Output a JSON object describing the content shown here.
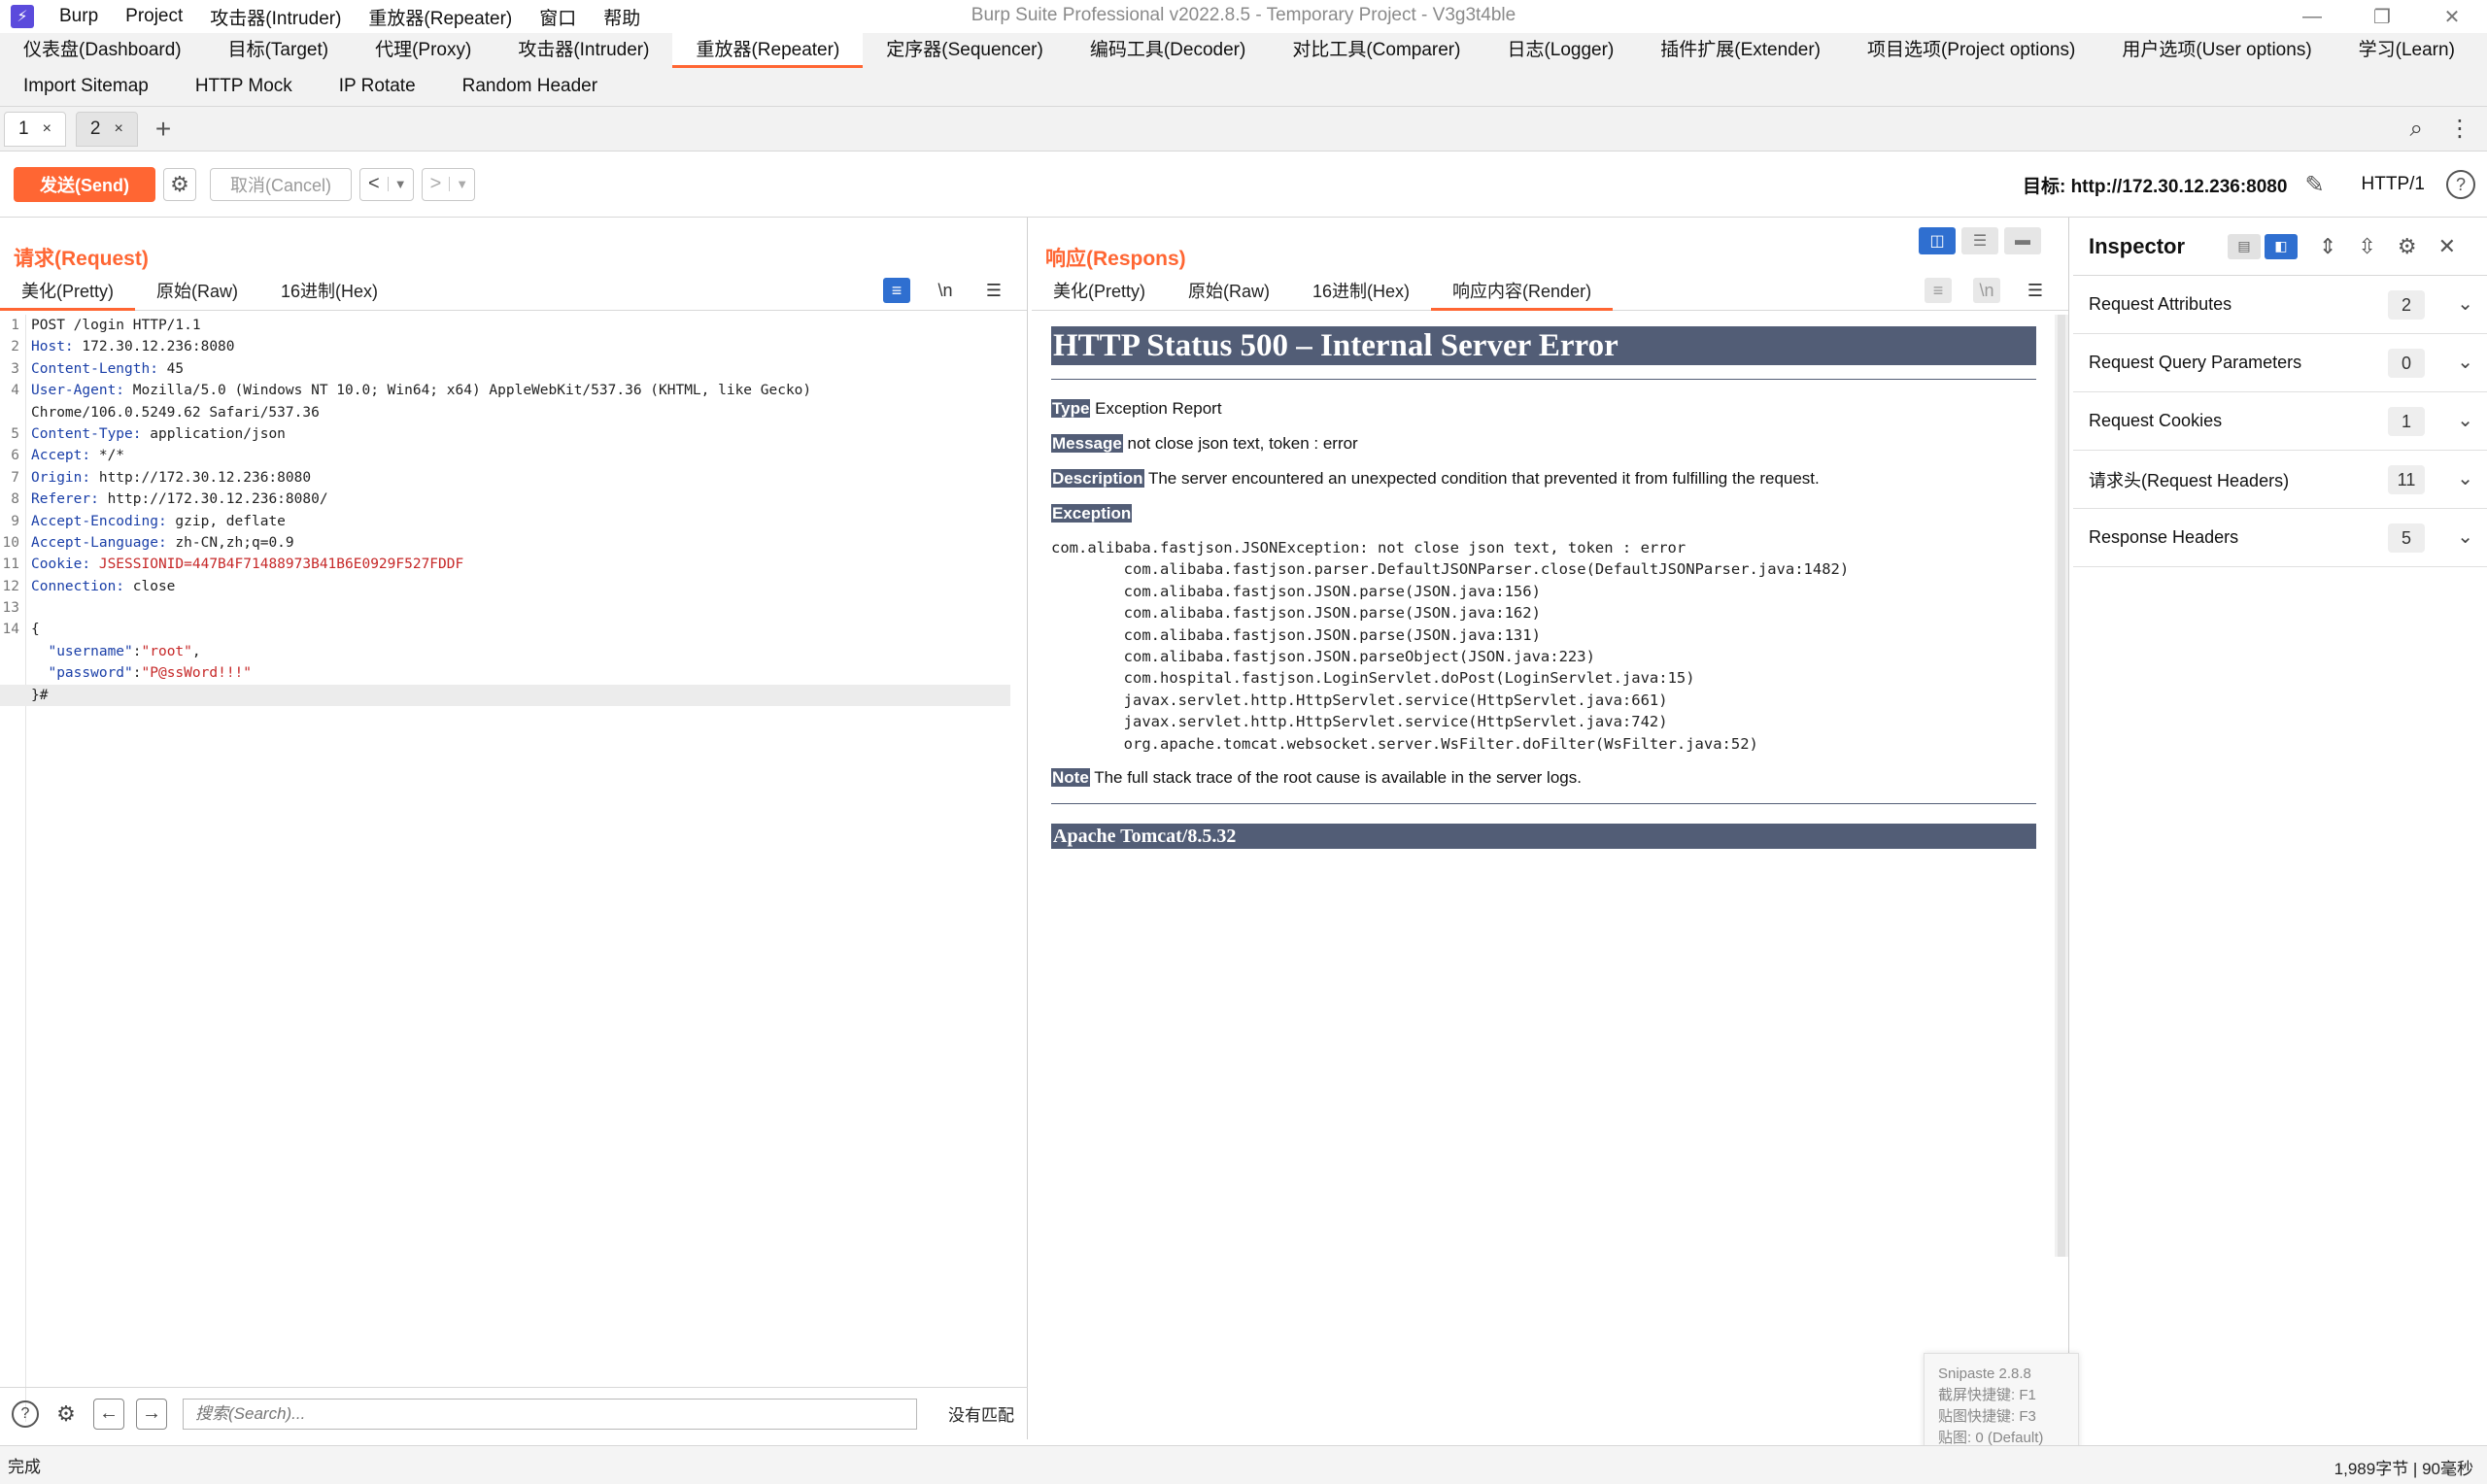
{
  "window": {
    "title": "Burp Suite Professional v2022.8.5 - Temporary Project - V3g3t4ble",
    "menu": [
      "Burp",
      "Project",
      "攻击器(Intruder)",
      "重放器(Repeater)",
      "窗口",
      "帮助"
    ]
  },
  "main_tabs": {
    "row1": [
      "仪表盘(Dashboard)",
      "目标(Target)",
      "代理(Proxy)",
      "攻击器(Intruder)",
      "重放器(Repeater)",
      "定序器(Sequencer)",
      "编码工具(Decoder)",
      "对比工具(Comparer)",
      "日志(Logger)",
      "插件扩展(Extender)",
      "项目选项(Project options)",
      "用户选项(User options)",
      "学习(Learn)"
    ],
    "row2": [
      "Import Sitemap",
      "HTTP Mock",
      "IP Rotate",
      "Random Header"
    ],
    "active": "重放器(Repeater)"
  },
  "repeater_tabs": [
    {
      "label": "1",
      "close": "×"
    },
    {
      "label": "2",
      "close": "×"
    }
  ],
  "toolbar": {
    "send": "发送(Send)",
    "cancel": "取消(Cancel)",
    "target": "目标: http://172.30.12.236:8080",
    "http_version": "HTTP/1"
  },
  "request": {
    "title": "请求(Request)",
    "view_tabs": [
      "美化(Pretty)",
      "原始(Raw)",
      "16进制(Hex)"
    ],
    "active_view": "美化(Pretty)",
    "newline_toggle": "\\n",
    "lines": [
      {
        "n": "1",
        "k": "",
        "v": "POST /login HTTP/1.1"
      },
      {
        "n": "2",
        "k": "Host:",
        "v": " 172.30.12.236:8080"
      },
      {
        "n": "3",
        "k": "Content-Length:",
        "v": " 45"
      },
      {
        "n": "4",
        "k": "User-Agent:",
        "v": " Mozilla/5.0 (Windows NT 10.0; Win64; x64) AppleWebKit/537.36 (KHTML, like Gecko)"
      },
      {
        "n": "",
        "k": "",
        "v": "Chrome/106.0.5249.62 Safari/537.36"
      },
      {
        "n": "5",
        "k": "Content-Type:",
        "v": " application/json"
      },
      {
        "n": "6",
        "k": "Accept:",
        "v": " */*"
      },
      {
        "n": "7",
        "k": "Origin:",
        "v": " http://172.30.12.236:8080"
      },
      {
        "n": "8",
        "k": "Referer:",
        "v": " http://172.30.12.236:8080/"
      },
      {
        "n": "9",
        "k": "Accept-Encoding:",
        "v": " gzip, deflate"
      },
      {
        "n": "10",
        "k": "Accept-Language:",
        "v": " zh-CN,zh;q=0.9"
      },
      {
        "n": "11",
        "k": "Cookie:",
        "v": " ",
        "cookie": "JSESSIONID=447B4F71488973B41B6E0929F527FDDF"
      },
      {
        "n": "12",
        "k": "Connection:",
        "v": " close"
      },
      {
        "n": "13",
        "k": "",
        "v": ""
      },
      {
        "n": "14",
        "k": "",
        "v": "{"
      }
    ],
    "json_body": {
      "username_key": "\"username\"",
      "username_val": "\"root\"",
      "password_key": "\"password\"",
      "password_val": "\"P@ssWord!!!\"",
      "close": "}#"
    },
    "search_placeholder": "搜索(Search)...",
    "search_status": "没有匹配"
  },
  "response": {
    "title": "响应(Respons)",
    "view_tabs": [
      "美化(Pretty)",
      "原始(Raw)",
      "16进制(Hex)",
      "响应内容(Render)"
    ],
    "active_view": "响应内容(Render)",
    "newline_toggle": "\\n",
    "render": {
      "heading": "HTTP Status 500 – Internal Server Error",
      "type_label": "Type",
      "type_value": " Exception Report",
      "message_label": "Message",
      "message_value": " not close json text, token : error",
      "description_label": "Description",
      "description_value": " The server encountered an unexpected condition that prevented it from fulfilling the request.",
      "exception_label": "Exception",
      "stack_trace": "com.alibaba.fastjson.JSONException: not close json text, token : error\n\tcom.alibaba.fastjson.parser.DefaultJSONParser.close(DefaultJSONParser.java:1482)\n\tcom.alibaba.fastjson.JSON.parse(JSON.java:156)\n\tcom.alibaba.fastjson.JSON.parse(JSON.java:162)\n\tcom.alibaba.fastjson.JSON.parse(JSON.java:131)\n\tcom.alibaba.fastjson.JSON.parseObject(JSON.java:223)\n\tcom.hospital.fastjson.LoginServlet.doPost(LoginServlet.java:15)\n\tjavax.servlet.http.HttpServlet.service(HttpServlet.java:661)\n\tjavax.servlet.http.HttpServlet.service(HttpServlet.java:742)\n\torg.apache.tomcat.websocket.server.WsFilter.doFilter(WsFilter.java:52)",
      "note_label": "Note",
      "note_value": " The full stack trace of the root cause is available in the server logs.",
      "footer": "Apache Tomcat/8.5.32"
    }
  },
  "inspector": {
    "title": "Inspector",
    "sections": [
      {
        "label": "Request Attributes",
        "count": "2"
      },
      {
        "label": "Request Query Parameters",
        "count": "0"
      },
      {
        "label": "Request Cookies",
        "count": "1"
      },
      {
        "label": "请求头(Request Headers)",
        "count": "11"
      },
      {
        "label": "Response Headers",
        "count": "5"
      }
    ]
  },
  "snipaste": {
    "line1": "Snipaste 2.8.8",
    "line2": "截屏快捷键: F1",
    "line3": "贴图快捷键: F3",
    "line4": "贴图: 0 (Default)"
  },
  "status": {
    "left": "完成",
    "right": "1,989字节 | 90毫秒"
  },
  "colors": {
    "accent": "#ff6633",
    "active_toggle": "#2f6fd0",
    "tomcat_header": "#525d76"
  }
}
